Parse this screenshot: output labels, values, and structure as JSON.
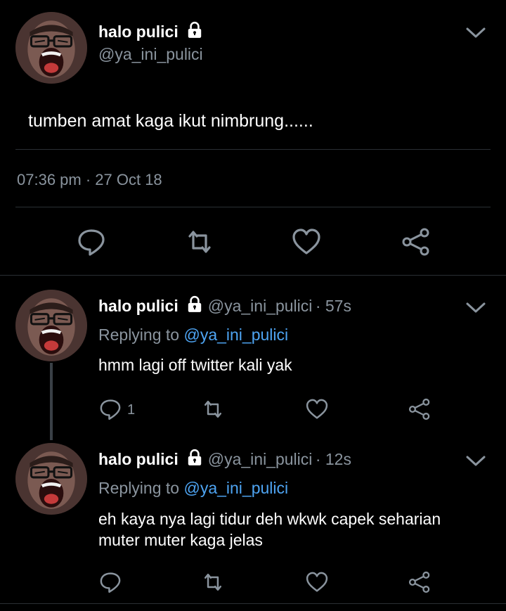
{
  "main_tweet": {
    "name": "halo pulici",
    "handle": "@ya_ini_pulici",
    "text": "tumben amat kaga ikut nimbrung......",
    "timestamp": "07:36 pm · 27 Oct 18"
  },
  "replies": [
    {
      "name": "halo pulici",
      "handle": "@ya_ini_pulici",
      "time": "· 57s",
      "replying_prefix": "Replying to",
      "replying_to": "@ya_ini_pulici",
      "text": "hmm lagi off twitter kali yak",
      "reply_count": "1"
    },
    {
      "name": "halo pulici",
      "handle": "@ya_ini_pulici",
      "time": "· 12s",
      "replying_prefix": "Replying to",
      "replying_to": "@ya_ini_pulici",
      "text_line1": "eh kaya nya lagi tidur deh wkwk capek seharian",
      "text_line2": "muter muter kaga jelas"
    }
  ],
  "icons": [
    "lock-icon",
    "chevron-down-icon",
    "reply-icon",
    "retweet-icon",
    "like-icon",
    "share-icon"
  ],
  "colors": {
    "background": "#000000",
    "muted": "#8a949e",
    "link": "#4ea4f2",
    "divider": "#2a2f34"
  }
}
